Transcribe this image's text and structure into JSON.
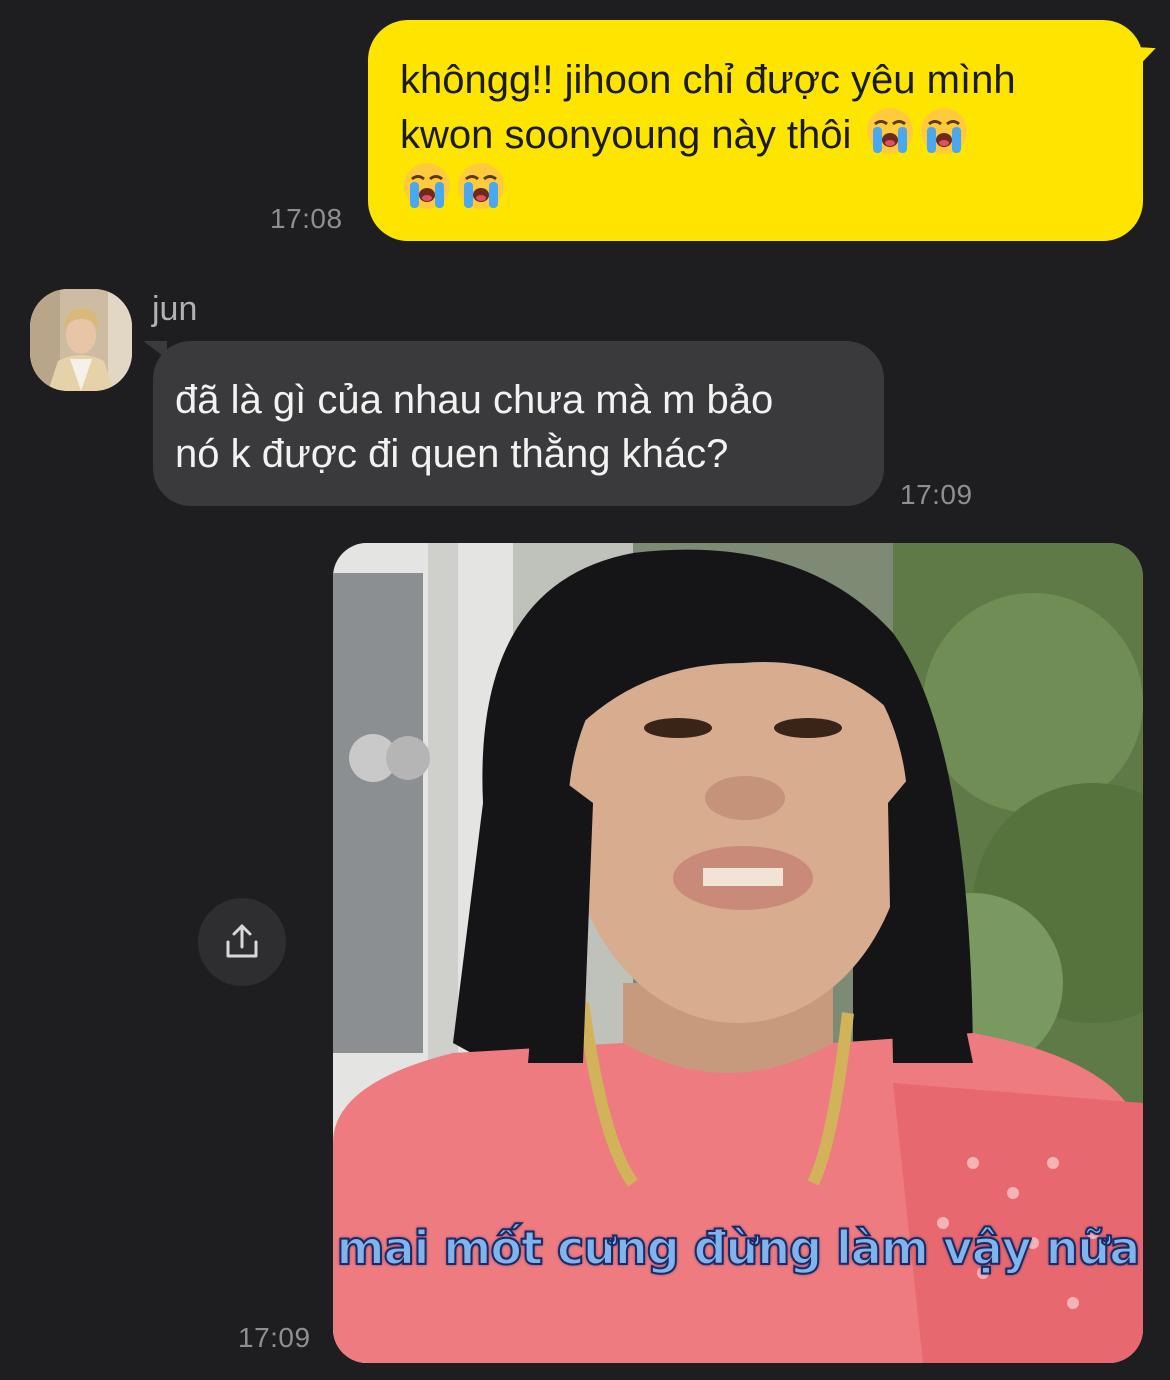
{
  "messages": [
    {
      "direction": "outgoing",
      "line1": "khôngg!! jihoon chỉ được yêu mình",
      "line2": "kwon soonyoung này thôi",
      "emoji": "loudly-crying-face",
      "emoji_count": 4,
      "time": "17:08"
    },
    {
      "direction": "incoming",
      "sender": "jun",
      "line1": "đã là gì của nhau chưa mà m bảo",
      "line2": "nó k được đi quen thằng khác?",
      "time": "17:09"
    },
    {
      "direction": "incoming",
      "type": "image",
      "caption": "mai mốt cưng đừng làm vậy nữa",
      "time": "17:09"
    }
  ],
  "icons": {
    "share": "share-icon"
  },
  "colors": {
    "background": "#1e1e20",
    "outgoing_bubble": "#fde500",
    "incoming_bubble": "#3a3a3c",
    "timestamp": "#8e8e93"
  }
}
